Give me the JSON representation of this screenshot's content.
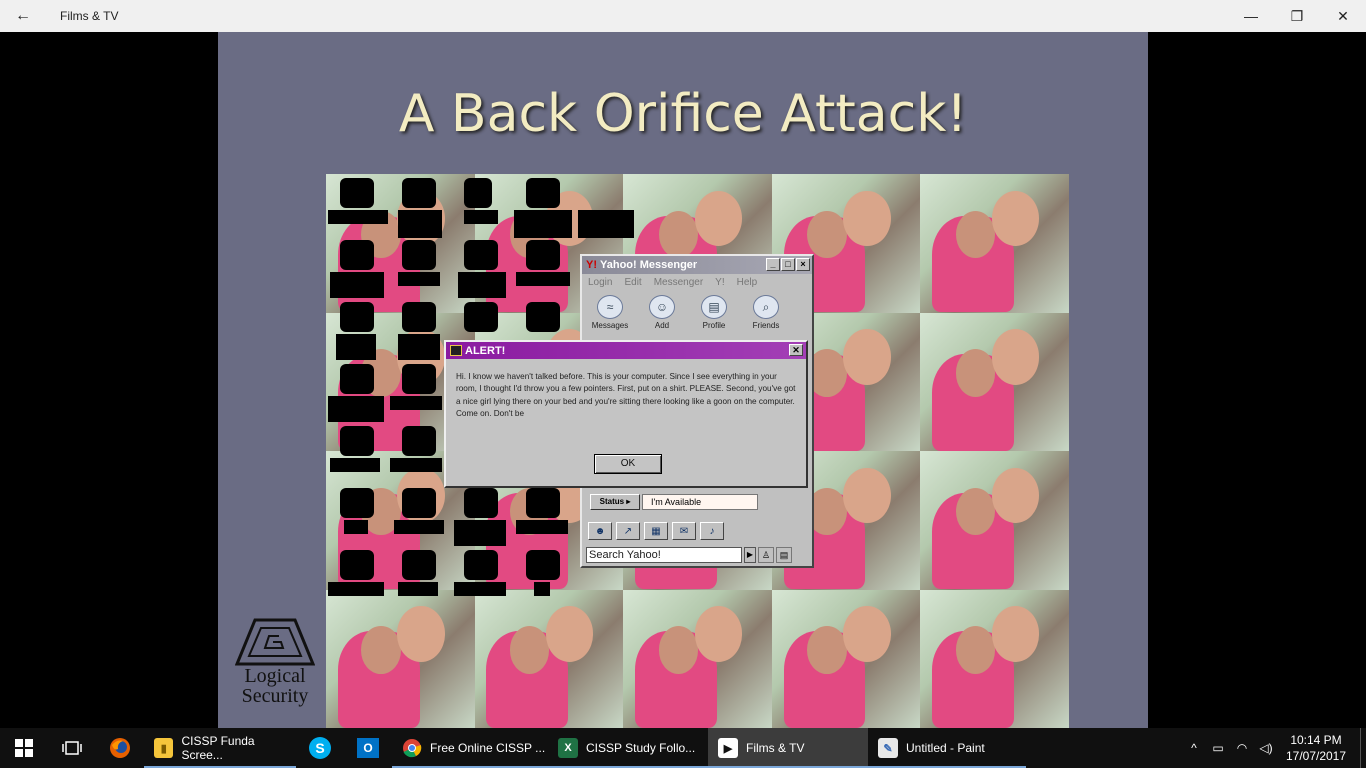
{
  "window": {
    "title": "Films & TV",
    "back_icon": "←",
    "minimize_icon": "—",
    "restore_icon": "❐",
    "close_icon": "✕"
  },
  "slide": {
    "title": "A Back Orifice Attack!",
    "logo_line1": "Logical",
    "logo_line2": "Security"
  },
  "yahoo": {
    "title": "Yahoo! Messenger",
    "badge": "Y!",
    "menu": [
      "Login",
      "Edit",
      "Messenger",
      "Y!",
      "Help"
    ],
    "tools": [
      {
        "label": "Messages",
        "icon": "≈"
      },
      {
        "label": "Add",
        "icon": "☺"
      },
      {
        "label": "Profile",
        "icon": "▤"
      },
      {
        "label": "Friends",
        "icon": "⌕"
      }
    ],
    "status_button": "Status ▸",
    "status_value": "I'm Available",
    "search_placeholder": "Search Yahoo!",
    "search_go": "▶"
  },
  "alert": {
    "title": "ALERT!",
    "message": "Hi. I know we haven't talked before. This is your computer. Since I see everything in your room, I thought I'd throw you a few pointers. First, put on a shirt. PLEASE. Second, you've got a nice girl lying there on your bed and you're sitting there looking like a goon on the computer. Come on. Don't be",
    "ok_label": "OK",
    "close_icon": "✕"
  },
  "taskbar": {
    "apps": [
      {
        "label": "CISSP Funda Scree...",
        "glyph": "▮",
        "color": "#f5c53b",
        "fg": "#7a5a00",
        "open": true,
        "active": false
      },
      {
        "label": "Free Online CISSP ...",
        "glyph": "●",
        "color": "#ffffff",
        "fg": "#db4437",
        "open": true,
        "active": false
      },
      {
        "label": "CISSP  Study Follo...",
        "glyph": "X",
        "color": "#1f7244",
        "fg": "#ffffff",
        "open": true,
        "active": false
      },
      {
        "label": "Films & TV",
        "glyph": "▶",
        "color": "#ffffff",
        "fg": "#111111",
        "open": true,
        "active": true
      },
      {
        "label": "Untitled - Paint",
        "glyph": "✎",
        "color": "#e8e8e8",
        "fg": "#3b6cb6",
        "open": true,
        "active": false
      }
    ],
    "pinned_firefox": "firefox",
    "pinned_skype": "S",
    "pinned_outlook": "O",
    "clock_time": "10:14 PM",
    "clock_date": "17/07/2017"
  }
}
